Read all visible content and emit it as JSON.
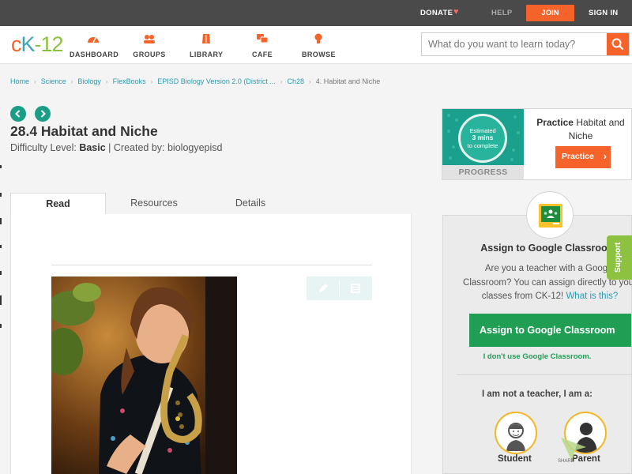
{
  "topbar": {
    "donate": "DONATE",
    "help": "HELP",
    "join": "JOIN",
    "signin": "SIGN IN"
  },
  "header": {
    "logo_c": "c",
    "logo_k": "K",
    "logo_rest": "-12",
    "nav": [
      "DASHBOARD",
      "GROUPS",
      "LIBRARY",
      "CAFE",
      "BROWSE"
    ],
    "search_placeholder": "What do you want to learn today?"
  },
  "breadcrumb": {
    "items": [
      "Home",
      "Science",
      "Biology",
      "FlexBooks",
      "EPISD Biology Version 2.0 (District ...",
      "Ch28"
    ],
    "current": "4. Habitat and Niche"
  },
  "lesson": {
    "title": "28.4 Habitat and Niche",
    "difficulty_label": "Difficulty Level:",
    "difficulty": "Basic",
    "created_by": "| Created by: biologyepisd"
  },
  "tabs": [
    "Read",
    "Resources",
    "Details"
  ],
  "practice": {
    "estimate_1": "Estimated",
    "estimate_2": "3 mins",
    "estimate_3": "to complete",
    "progress": "PROGRESS",
    "title_bold": "Practice",
    "title_rest": "Habitat and Niche",
    "button": "Practice"
  },
  "classroom": {
    "title": "Assign to Google Classroom",
    "desc_line1": "Are you a teacher with a Google",
    "desc_line2": "Classroom? You can assign directly to your",
    "desc_line3": "classes from CK-12!",
    "desc_link": "What is this?",
    "button": "Assign to Google Classroom",
    "no_use": "I don't use Google Classroom.",
    "not_teacher": "I am not a teacher, I am a:",
    "student": "Student",
    "parent": "Parent"
  },
  "support": "Support",
  "share": "SHARE",
  "colors": {
    "accent": "#f5632a",
    "teal": "#1a9e86",
    "green": "#1f9e54",
    "link": "#2a9bb0"
  }
}
